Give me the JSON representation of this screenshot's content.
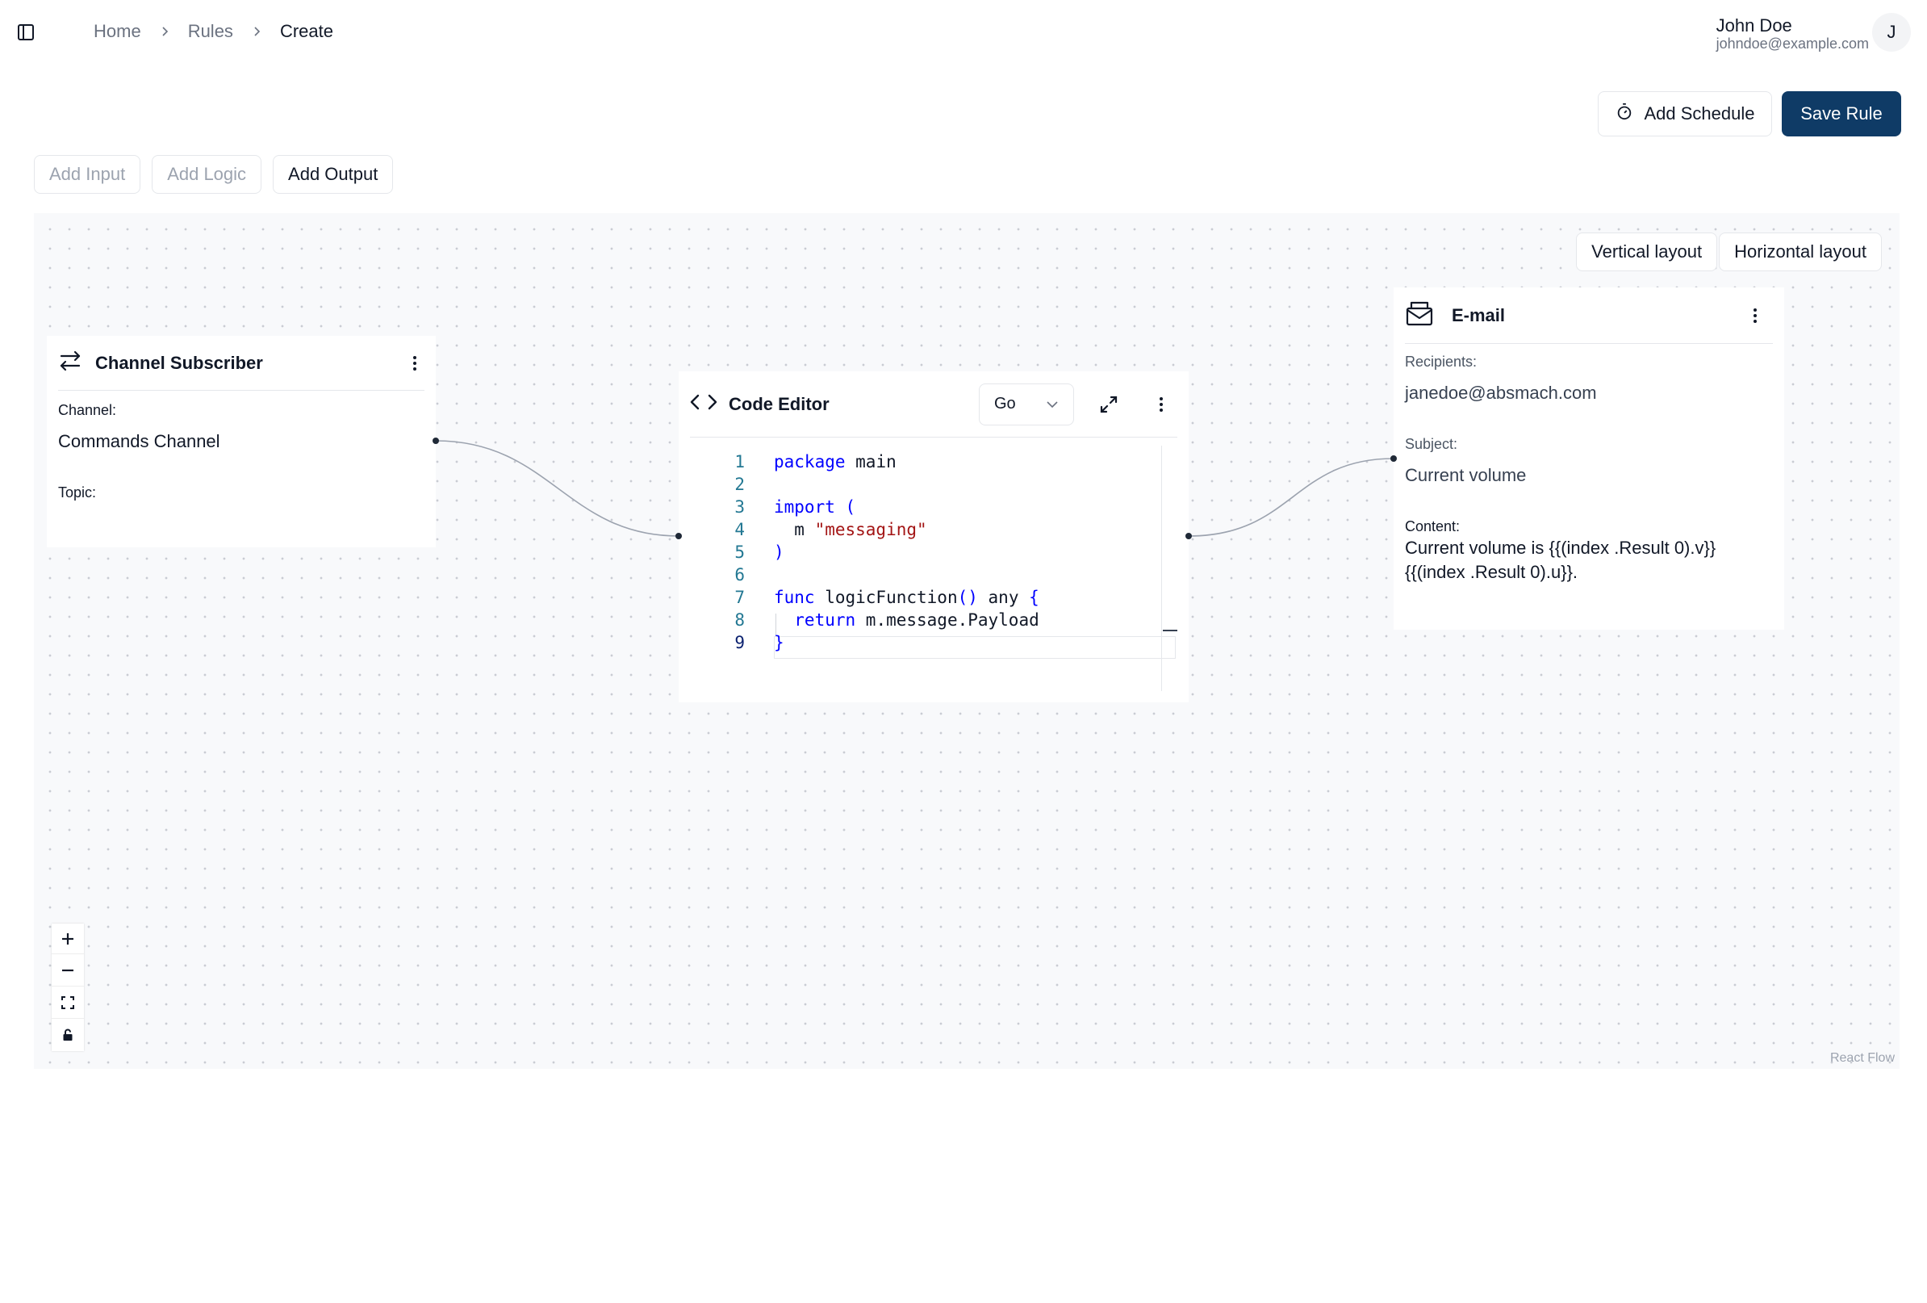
{
  "breadcrumb": [
    "Home",
    "Rules",
    "Create"
  ],
  "user": {
    "name": "John Doe",
    "email": "johndoe@example.com",
    "initial": "J"
  },
  "actions": {
    "schedule": "Add Schedule",
    "save": "Save Rule"
  },
  "add_buttons": {
    "input": "Add Input",
    "logic": "Add Logic",
    "output": "Add Output"
  },
  "layout": {
    "vertical": "Vertical layout",
    "horizontal": "Horizontal layout"
  },
  "nodes": {
    "subscriber": {
      "title": "Channel Subscriber",
      "channel_label": "Channel:",
      "channel_value": "Commands Channel",
      "topic_label": "Topic:"
    },
    "code": {
      "title": "Code Editor",
      "language": "Go",
      "line_numbers": [
        "1",
        "2",
        "3",
        "4",
        "5",
        "6",
        "7",
        "8",
        "9"
      ]
    },
    "email": {
      "title": "E-mail",
      "recipients_label": "Recipients:",
      "recipients_value": "janedoe@absmach.com",
      "subject_label": "Subject:",
      "subject_value": "Current volume",
      "content_label": "Content:",
      "content_line1": "Current volume is {{(index .Result 0).v}}",
      "content_line2": "{{(index .Result 0).u}}."
    }
  },
  "code_tokens": {
    "l1_kw": "package",
    "l1_rest": " main",
    "l3_kw": "import",
    "l3_paren": " (",
    "l4_pre": "  m ",
    "l4_str": "\"messaging\"",
    "l5_paren": ")",
    "l7_kw": "func",
    "l7_name": " logicFunction",
    "l7_paren": "()",
    "l7_any": " any ",
    "l7_brace": "{",
    "l8_kw": "  return",
    "l8_rest": " m.message.Payload",
    "l9_brace": "}"
  },
  "attribution": "React Flow",
  "colors": {
    "primary": "#0f3b66",
    "canvas": "#f8f9fb",
    "keyword": "#0000ff",
    "string": "#a31515",
    "line_number": "#237893"
  }
}
